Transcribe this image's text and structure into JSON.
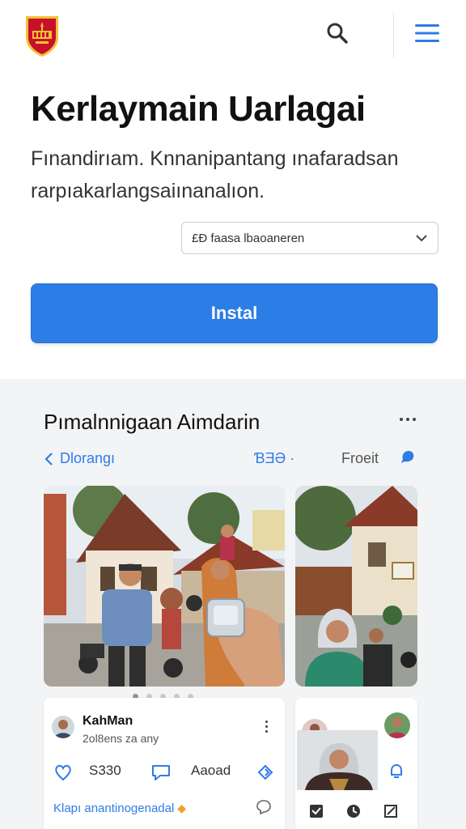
{
  "header": {
    "logo_icon": "crest-logo-icon",
    "search_icon": "search-icon",
    "menu_icon": "hamburger-menu-icon"
  },
  "hero": {
    "title": "Kerlaymain Uarlagai",
    "description": "Fınandirıam. Knnanipantang ınafaradsan rarpıakarlangsaiınanalıon.",
    "select_value": "£Ð faasa lbaoaneren",
    "install_label": "Instal"
  },
  "section": {
    "title": "Pımalnnigaan Aimdarin",
    "tabs": {
      "back_label": "Dlorangı",
      "center_label": "ƁƎƏ ·",
      "front_label": "Froeit"
    },
    "carousel": {
      "dots": 5,
      "active_dot": 0
    },
    "post": {
      "name": "KahMan",
      "time": "2ol8ens za any",
      "likes": "S330",
      "comments": "Aaoad",
      "link_text": "Klapı anantinogenadal"
    }
  },
  "colors": {
    "accent": "#2d7de6",
    "section_bg": "#f3f4f6",
    "logo_red": "#c8102e",
    "logo_gold": "#f2c230"
  }
}
